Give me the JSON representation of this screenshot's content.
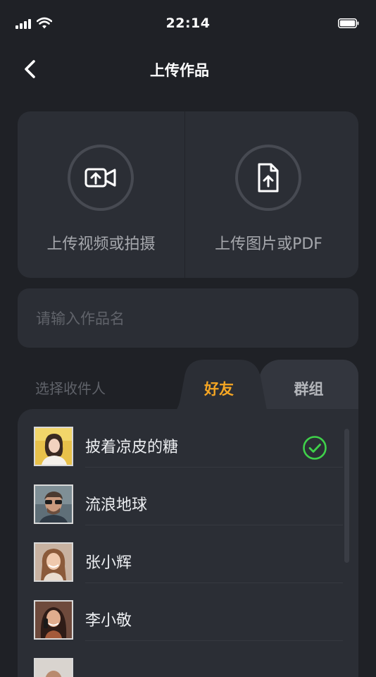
{
  "status_bar": {
    "time": "22:14"
  },
  "nav": {
    "title": "上传作品"
  },
  "upload": {
    "video_label": "上传视频或拍摄",
    "image_label": "上传图片或PDF"
  },
  "name_input": {
    "placeholder": "请输入作品名",
    "value": ""
  },
  "recipients": {
    "label": "选择收件人",
    "tabs": [
      {
        "label": "好友",
        "active": true
      },
      {
        "label": "群组",
        "active": false
      }
    ],
    "items": [
      {
        "name": "披着凉皮的糖",
        "selected": true
      },
      {
        "name": "流浪地球",
        "selected": false
      },
      {
        "name": "张小辉",
        "selected": false
      },
      {
        "name": "李小敬",
        "selected": false
      },
      {
        "name": "",
        "selected": false
      }
    ]
  },
  "colors": {
    "background": "#1f2126",
    "card": "#2b2e35",
    "accent": "#f5a623",
    "check": "#3fd14a"
  }
}
